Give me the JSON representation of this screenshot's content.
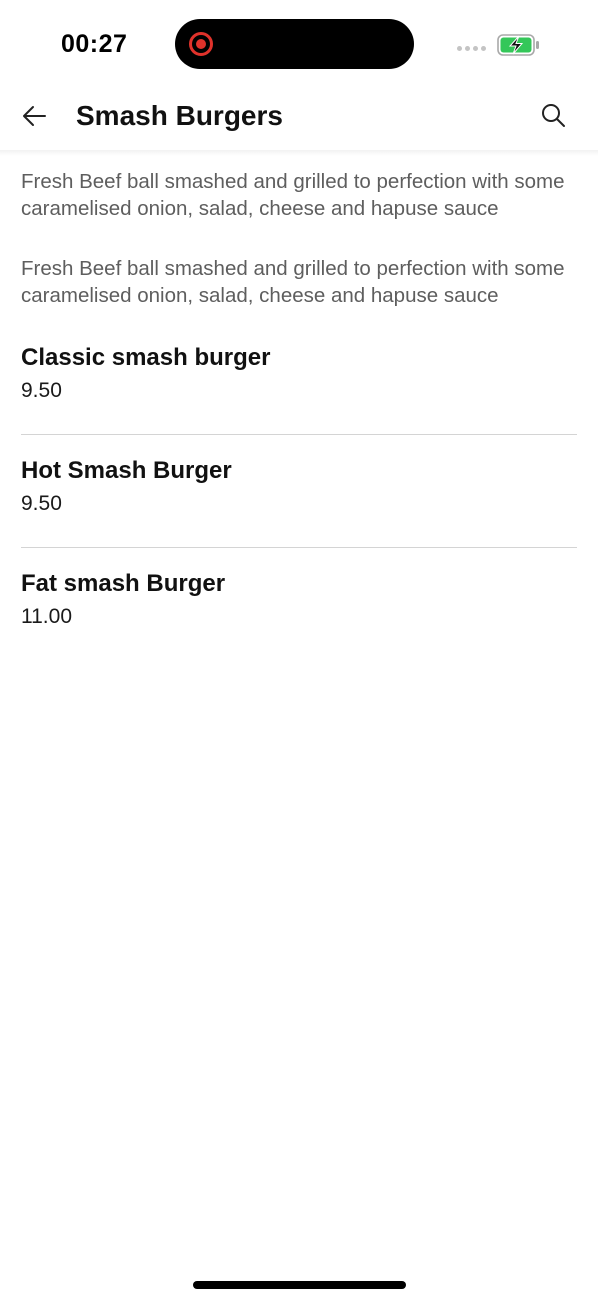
{
  "status_bar": {
    "time": "00:27",
    "battery_color": "#34c759"
  },
  "header": {
    "title": "Smash Burgers",
    "back_icon": "arrow-left-icon",
    "search_icon": "search-icon"
  },
  "descriptions": [
    "Fresh Beef ball smashed and grilled to perfection with some caramelised onion, salad, cheese and hapuse sauce",
    "Fresh Beef ball smashed and grilled to perfection with some caramelised onion, salad, cheese and hapuse sauce"
  ],
  "menu_items": [
    {
      "name": "Classic smash  burger",
      "price": "9.50"
    },
    {
      "name": "Hot Smash Burger",
      "price": "9.50"
    },
    {
      "name": "Fat smash Burger",
      "price": "11.00"
    }
  ]
}
